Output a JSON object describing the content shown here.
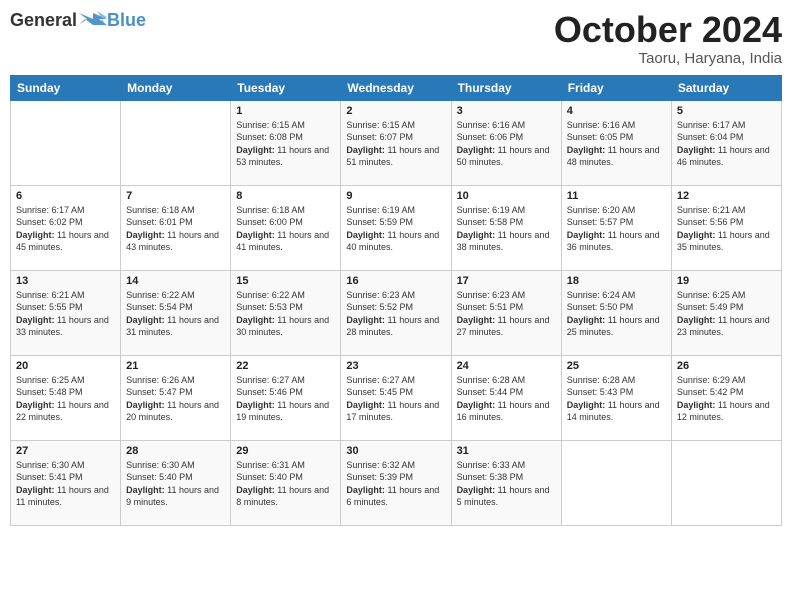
{
  "header": {
    "logo_general": "General",
    "logo_blue": "Blue",
    "title": "October 2024",
    "subtitle": "Taoru, Haryana, India"
  },
  "days_of_week": [
    "Sunday",
    "Monday",
    "Tuesday",
    "Wednesday",
    "Thursday",
    "Friday",
    "Saturday"
  ],
  "weeks": [
    [
      {
        "day": "",
        "content": ""
      },
      {
        "day": "",
        "content": ""
      },
      {
        "day": "1",
        "content": "Sunrise: 6:15 AM\nSunset: 6:08 PM\nDaylight: 11 hours and 53 minutes."
      },
      {
        "day": "2",
        "content": "Sunrise: 6:15 AM\nSunset: 6:07 PM\nDaylight: 11 hours and 51 minutes."
      },
      {
        "day": "3",
        "content": "Sunrise: 6:16 AM\nSunset: 6:06 PM\nDaylight: 11 hours and 50 minutes."
      },
      {
        "day": "4",
        "content": "Sunrise: 6:16 AM\nSunset: 6:05 PM\nDaylight: 11 hours and 48 minutes."
      },
      {
        "day": "5",
        "content": "Sunrise: 6:17 AM\nSunset: 6:04 PM\nDaylight: 11 hours and 46 minutes."
      }
    ],
    [
      {
        "day": "6",
        "content": "Sunrise: 6:17 AM\nSunset: 6:02 PM\nDaylight: 11 hours and 45 minutes."
      },
      {
        "day": "7",
        "content": "Sunrise: 6:18 AM\nSunset: 6:01 PM\nDaylight: 11 hours and 43 minutes."
      },
      {
        "day": "8",
        "content": "Sunrise: 6:18 AM\nSunset: 6:00 PM\nDaylight: 11 hours and 41 minutes."
      },
      {
        "day": "9",
        "content": "Sunrise: 6:19 AM\nSunset: 5:59 PM\nDaylight: 11 hours and 40 minutes."
      },
      {
        "day": "10",
        "content": "Sunrise: 6:19 AM\nSunset: 5:58 PM\nDaylight: 11 hours and 38 minutes."
      },
      {
        "day": "11",
        "content": "Sunrise: 6:20 AM\nSunset: 5:57 PM\nDaylight: 11 hours and 36 minutes."
      },
      {
        "day": "12",
        "content": "Sunrise: 6:21 AM\nSunset: 5:56 PM\nDaylight: 11 hours and 35 minutes."
      }
    ],
    [
      {
        "day": "13",
        "content": "Sunrise: 6:21 AM\nSunset: 5:55 PM\nDaylight: 11 hours and 33 minutes."
      },
      {
        "day": "14",
        "content": "Sunrise: 6:22 AM\nSunset: 5:54 PM\nDaylight: 11 hours and 31 minutes."
      },
      {
        "day": "15",
        "content": "Sunrise: 6:22 AM\nSunset: 5:53 PM\nDaylight: 11 hours and 30 minutes."
      },
      {
        "day": "16",
        "content": "Sunrise: 6:23 AM\nSunset: 5:52 PM\nDaylight: 11 hours and 28 minutes."
      },
      {
        "day": "17",
        "content": "Sunrise: 6:23 AM\nSunset: 5:51 PM\nDaylight: 11 hours and 27 minutes."
      },
      {
        "day": "18",
        "content": "Sunrise: 6:24 AM\nSunset: 5:50 PM\nDaylight: 11 hours and 25 minutes."
      },
      {
        "day": "19",
        "content": "Sunrise: 6:25 AM\nSunset: 5:49 PM\nDaylight: 11 hours and 23 minutes."
      }
    ],
    [
      {
        "day": "20",
        "content": "Sunrise: 6:25 AM\nSunset: 5:48 PM\nDaylight: 11 hours and 22 minutes."
      },
      {
        "day": "21",
        "content": "Sunrise: 6:26 AM\nSunset: 5:47 PM\nDaylight: 11 hours and 20 minutes."
      },
      {
        "day": "22",
        "content": "Sunrise: 6:27 AM\nSunset: 5:46 PM\nDaylight: 11 hours and 19 minutes."
      },
      {
        "day": "23",
        "content": "Sunrise: 6:27 AM\nSunset: 5:45 PM\nDaylight: 11 hours and 17 minutes."
      },
      {
        "day": "24",
        "content": "Sunrise: 6:28 AM\nSunset: 5:44 PM\nDaylight: 11 hours and 16 minutes."
      },
      {
        "day": "25",
        "content": "Sunrise: 6:28 AM\nSunset: 5:43 PM\nDaylight: 11 hours and 14 minutes."
      },
      {
        "day": "26",
        "content": "Sunrise: 6:29 AM\nSunset: 5:42 PM\nDaylight: 11 hours and 12 minutes."
      }
    ],
    [
      {
        "day": "27",
        "content": "Sunrise: 6:30 AM\nSunset: 5:41 PM\nDaylight: 11 hours and 11 minutes."
      },
      {
        "day": "28",
        "content": "Sunrise: 6:30 AM\nSunset: 5:40 PM\nDaylight: 11 hours and 9 minutes."
      },
      {
        "day": "29",
        "content": "Sunrise: 6:31 AM\nSunset: 5:40 PM\nDaylight: 11 hours and 8 minutes."
      },
      {
        "day": "30",
        "content": "Sunrise: 6:32 AM\nSunset: 5:39 PM\nDaylight: 11 hours and 6 minutes."
      },
      {
        "day": "31",
        "content": "Sunrise: 6:33 AM\nSunset: 5:38 PM\nDaylight: 11 hours and 5 minutes."
      },
      {
        "day": "",
        "content": ""
      },
      {
        "day": "",
        "content": ""
      }
    ]
  ]
}
